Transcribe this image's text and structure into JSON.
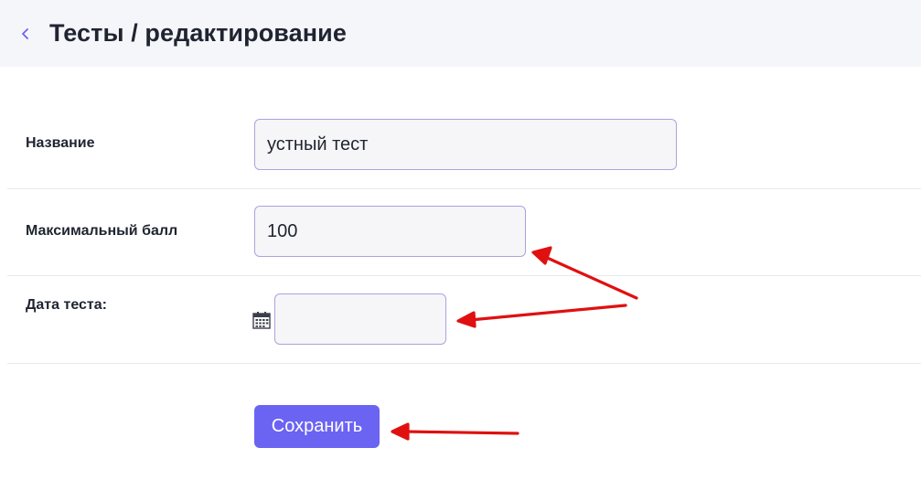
{
  "header": {
    "title": "Тесты / редактирование",
    "back_icon": "chevron-left-icon"
  },
  "form": {
    "name": {
      "label": "Название",
      "value": "устный тест"
    },
    "max_score": {
      "label": "Максимальный балл",
      "value": "100"
    },
    "test_date": {
      "label": "Дата теста:",
      "value": "",
      "icon": "calendar-icon"
    },
    "save_label": "Сохранить"
  },
  "colors": {
    "accent": "#6b63f2",
    "input_border": "#a9a3e0",
    "input_bg": "#f6f6f8",
    "header_bg": "#f5f6fa",
    "annotation_arrow": "#e01010"
  }
}
